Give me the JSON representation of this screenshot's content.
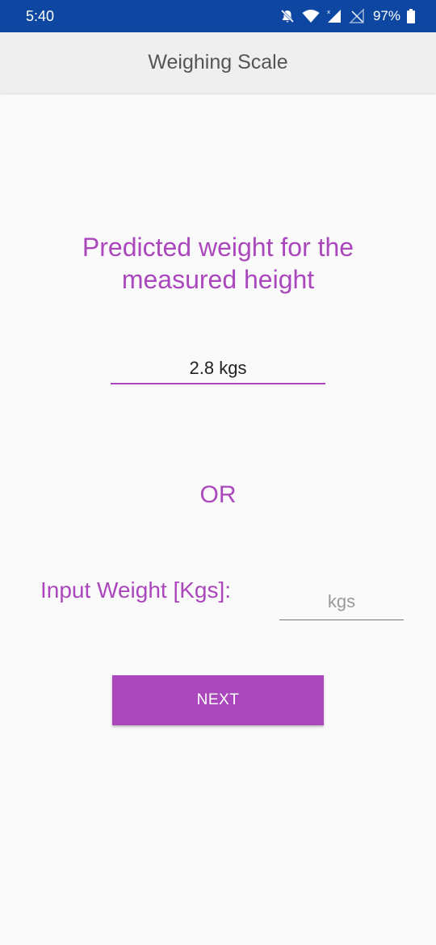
{
  "status_bar": {
    "time": "5:40",
    "battery_percent": "97%",
    "icons": [
      "mute-icon",
      "wifi-icon",
      "signal-icon",
      "no-sim-icon",
      "battery-icon"
    ]
  },
  "app_bar": {
    "title": "Weighing Scale"
  },
  "main": {
    "heading": "Predicted weight for the measured height",
    "predicted_value": "2.8 kgs",
    "or_label": "OR",
    "input_label": "Input Weight [Kgs]:",
    "input_placeholder": "kgs",
    "input_value": "",
    "next_label": "NEXT"
  },
  "colors": {
    "status_bar": "#0d47a1",
    "accent": "#ab47bc",
    "app_bar": "#efefef",
    "background": "#fafafa"
  }
}
